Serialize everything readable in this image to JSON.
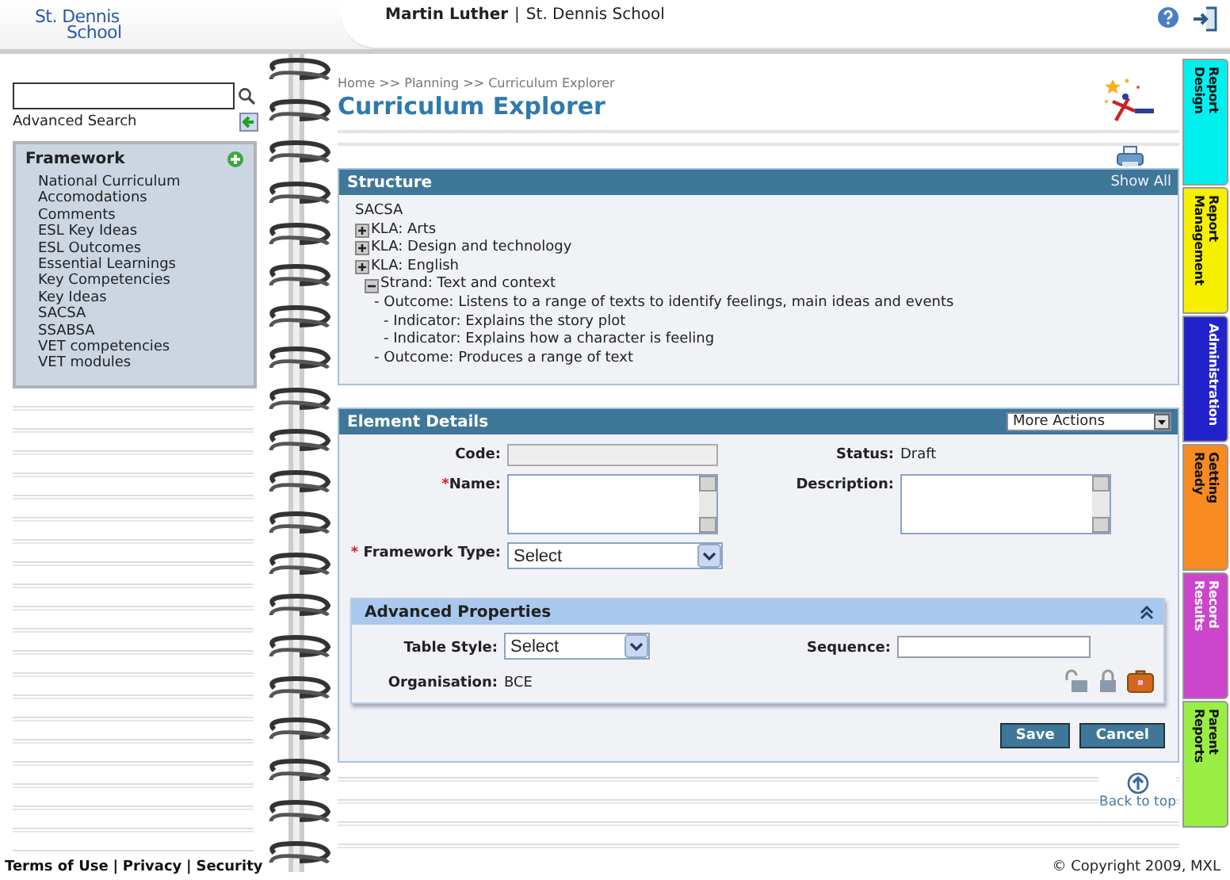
{
  "header": {
    "logo": [
      "St. Dennis",
      "School"
    ],
    "user": "Martin Luther",
    "separator": "|",
    "school": "St. Dennis School"
  },
  "sidebar": {
    "advanced_search": "Advanced Search",
    "framework": {
      "title": "Framework",
      "items": [
        "National Curriculum",
        "Accomodations",
        "Comments",
        "ESL Key Ideas",
        "ESL Outcomes",
        "Essential Learnings",
        "Key Competencies",
        "Key Ideas",
        "SACSA",
        "SSABSA",
        "VET competencies",
        "VET modules"
      ]
    }
  },
  "breadcrumb": "Home >> Planning >> Curriculum Explorer",
  "page_title": "Curriculum Explorer",
  "structure": {
    "title": "Structure",
    "action": "Show All",
    "tree": [
      {
        "text": "SACSA",
        "children": [
          {
            "text": "KLA: Arts",
            "expanded": false
          },
          {
            "text": "KLA: Design and technology",
            "expanded": false
          },
          {
            "text": "KLA: English",
            "expanded": false,
            "children": [
              {
                "text": "Strand: Text and context",
                "expanded": true,
                "children": [
                  {
                    "text": "- Outcome: Listens to a range of texts to identify feelings, main ideas and events",
                    "children": [
                      {
                        "text": "- Indicator: Explains the story plot"
                      },
                      {
                        "text": "- Indicator: Explains how a character is feeling"
                      }
                    ]
                  },
                  {
                    "text": "- Outcome: Produces a range of text"
                  }
                ]
              }
            ]
          }
        ]
      }
    ]
  },
  "element_details": {
    "title": "Element Details",
    "actions": {
      "value": "More Actions"
    },
    "code": {
      "label": "Code:",
      "disabled": true
    },
    "name": {
      "label": "Name:",
      "required_mark": "*"
    },
    "framework_type": {
      "label": "Framework Type:",
      "required_mark": "*",
      "value": "Select"
    },
    "status": {
      "label": "Status:",
      "value": "Draft"
    },
    "description": {
      "label": "Description:"
    },
    "advanced": {
      "title": "Advanced Properties",
      "expanded": true,
      "table_style": {
        "label": "Table Style:",
        "value": "Select"
      },
      "sequence": {
        "label": "Sequence:"
      },
      "organisation": {
        "label": "Organisation:",
        "value": "BCE"
      }
    },
    "buttons": [
      "Save",
      "Cancel"
    ]
  },
  "back_to_top": "Back to top",
  "side_tabs": [
    {
      "lines": [
        "Report",
        "Design"
      ],
      "color": "#00f0f0"
    },
    {
      "lines": [
        "Report",
        "Management"
      ],
      "color": "#f4f000"
    },
    {
      "lines": [
        "Administration"
      ],
      "color": "#2222cc"
    },
    {
      "lines": [
        "Getting",
        "Ready"
      ],
      "color": "#f88a22"
    },
    {
      "lines": [
        "Record",
        "Results"
      ],
      "color": "#cc44cc"
    },
    {
      "lines": [
        "Parent",
        "Reports"
      ],
      "color": "#99ee44"
    }
  ],
  "footer": {
    "links": [
      "Terms of Use",
      "Privacy",
      "Security"
    ],
    "separator": "|",
    "copyright": "© Copyright 2009, MXL"
  }
}
